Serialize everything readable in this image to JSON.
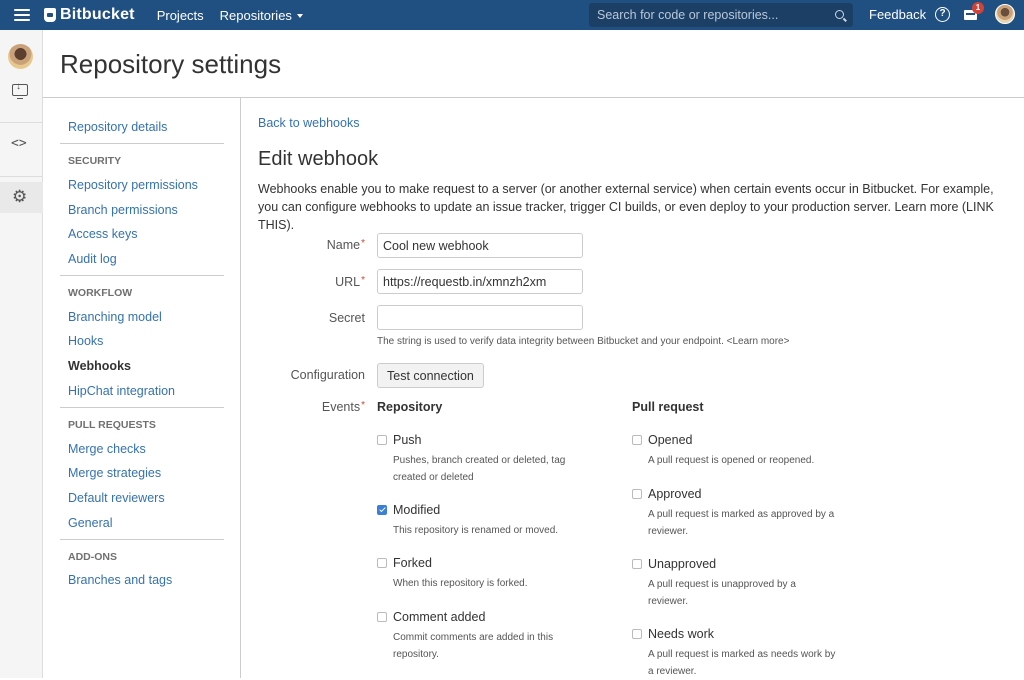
{
  "topbar": {
    "brand": "Bitbucket",
    "nav": [
      {
        "label": "Projects"
      },
      {
        "label": "Repositories"
      }
    ],
    "search_placeholder": "Search for code or repositories...",
    "feedback": "Feedback",
    "help_glyph": "?",
    "notifications_count": "1"
  },
  "rail": {
    "code_glyph": "<>",
    "gear_glyph": "⚙"
  },
  "page": {
    "title": "Repository settings"
  },
  "sidebar": {
    "items": [
      {
        "label": "Repository details"
      },
      {
        "heading": "SECURITY"
      },
      {
        "label": "Repository permissions"
      },
      {
        "label": "Branch permissions"
      },
      {
        "label": "Access keys"
      },
      {
        "label": "Audit log"
      },
      {
        "heading": "WORKFLOW"
      },
      {
        "label": "Branching model"
      },
      {
        "label": "Hooks"
      },
      {
        "label": "Webhooks",
        "active": true
      },
      {
        "label": "HipChat integration"
      },
      {
        "heading": "PULL REQUESTS"
      },
      {
        "label": "Merge checks"
      },
      {
        "label": "Merge strategies"
      },
      {
        "label": "Default reviewers"
      },
      {
        "label": "General"
      },
      {
        "heading": "ADD-ONS"
      },
      {
        "label": "Branches and tags"
      }
    ]
  },
  "main": {
    "back_link": "Back to webhooks",
    "title": "Edit webhook",
    "description": "Webhooks enable you to make request to a server (or another external service) when certain events occur in Bitbucket. For example, you can configure webhooks to update an issue tracker, trigger CI builds, or even deploy to your production server. Learn more (LINK THIS).",
    "form": {
      "name_label": "Name",
      "name_value": "Cool new webhook",
      "url_label": "URL",
      "url_value": "https://requestb.in/xmnzh2xm",
      "secret_label": "Secret",
      "secret_value": "",
      "secret_hint": "The string is used to verify data integrity between Bitbucket and your endpoint. <Learn more>",
      "config_label": "Configuration",
      "test_button": "Test connection",
      "events_label": "Events",
      "required_mark": "*"
    },
    "events": {
      "repository": {
        "heading": "Repository",
        "items": [
          {
            "label": "Push",
            "desc": "Pushes, branch created or deleted, tag created or deleted",
            "checked": false
          },
          {
            "label": "Modified",
            "desc": "This repository is renamed or moved.",
            "checked": true
          },
          {
            "label": "Forked",
            "desc": "When this repository is forked.",
            "checked": false
          },
          {
            "label": "Comment added",
            "desc": "Commit comments are added in this repository.",
            "checked": false
          }
        ]
      },
      "pull_request": {
        "heading": "Pull request",
        "items": [
          {
            "label": "Opened",
            "desc": "A pull request is opened or reopened.",
            "checked": false
          },
          {
            "label": "Approved",
            "desc": "A pull request is marked as approved by a reviewer.",
            "checked": false
          },
          {
            "label": "Unapproved",
            "desc": "A pull request is unapproved by a reviewer.",
            "checked": false
          },
          {
            "label": "Needs work",
            "desc": "A pull request is marked as needs work by a reviewer.",
            "checked": false
          }
        ]
      }
    }
  }
}
